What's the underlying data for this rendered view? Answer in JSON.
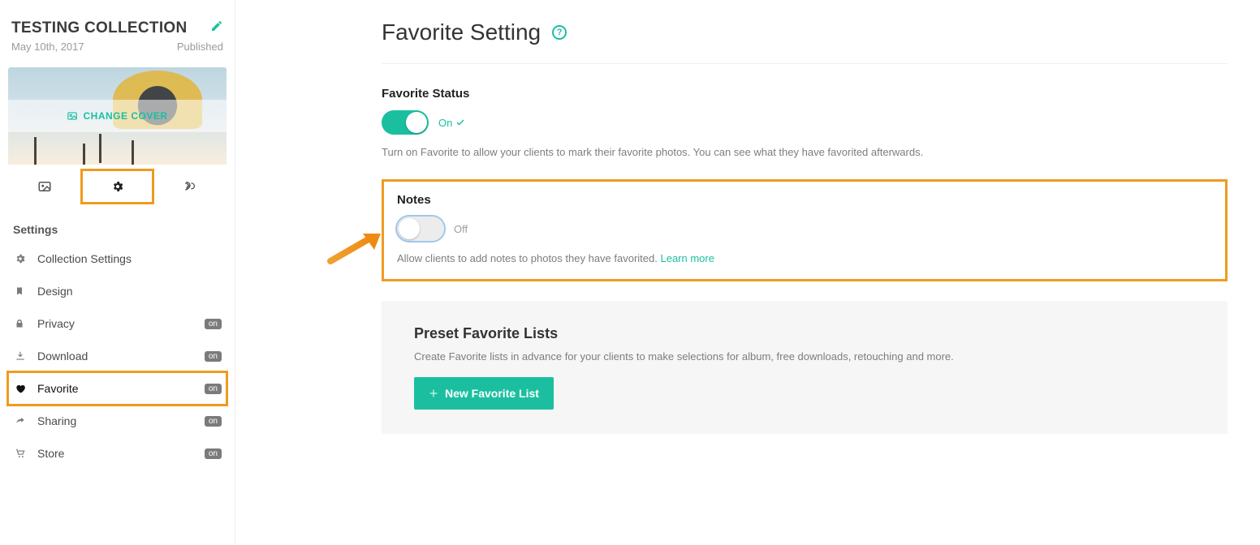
{
  "sidebar": {
    "title": "TESTING COLLECTION",
    "date": "May 10th, 2017",
    "status": "Published",
    "change_cover": "CHANGE COVER",
    "section_label": "Settings",
    "badge_on": "on",
    "items": [
      {
        "icon": "gear-icon",
        "label": "Collection Settings",
        "badge": false,
        "active": false
      },
      {
        "icon": "bookmark-icon",
        "label": "Design",
        "badge": false,
        "active": false
      },
      {
        "icon": "lock-icon",
        "label": "Privacy",
        "badge": true,
        "active": false
      },
      {
        "icon": "download-icon",
        "label": "Download",
        "badge": true,
        "active": false
      },
      {
        "icon": "heart-icon",
        "label": "Favorite",
        "badge": true,
        "active": true
      },
      {
        "icon": "share-icon",
        "label": "Sharing",
        "badge": true,
        "active": false
      },
      {
        "icon": "cart-icon",
        "label": "Store",
        "badge": true,
        "active": false
      }
    ]
  },
  "page": {
    "title": "Favorite Setting"
  },
  "favorite_status": {
    "heading": "Favorite Status",
    "state": "On",
    "hint": "Turn on Favorite to allow your clients to mark their favorite photos. You can see what they have favorited afterwards."
  },
  "notes": {
    "heading": "Notes",
    "state": "Off",
    "hint": "Allow clients to add notes to photos they have favorited. ",
    "learn_more": "Learn more"
  },
  "preset": {
    "heading": "Preset Favorite Lists",
    "desc": "Create Favorite lists in advance for your clients to make selections for album, free downloads, retouching and more.",
    "button": "New Favorite List"
  },
  "colors": {
    "accent": "#1bbfa0",
    "highlight": "#ef9b1f"
  }
}
